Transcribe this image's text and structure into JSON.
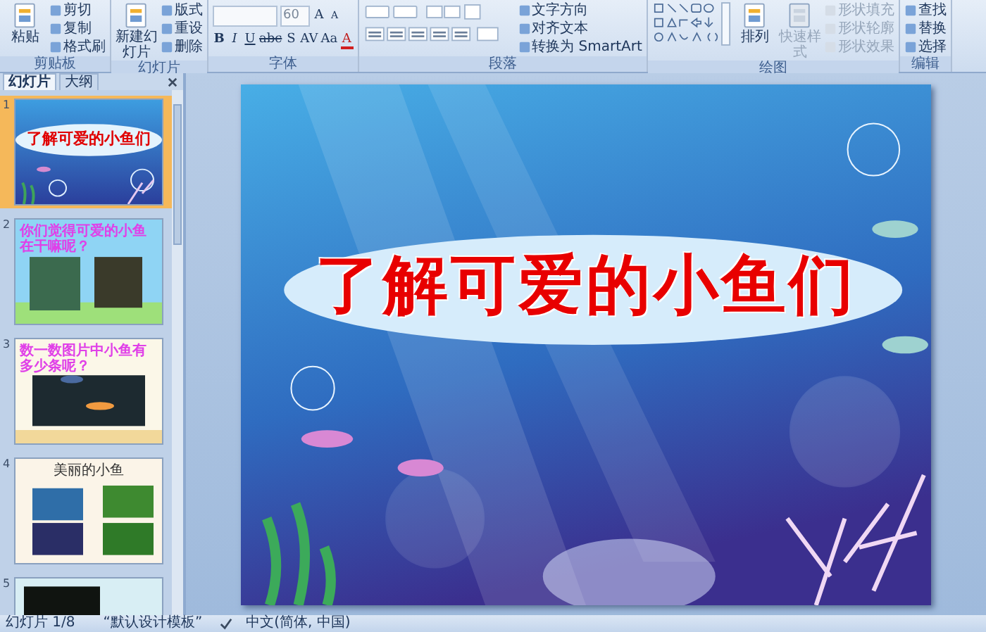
{
  "ribbon": {
    "groups": [
      {
        "label": "剪贴板",
        "kind": "buttons",
        "large": [
          {
            "label": "粘贴",
            "disabled": false
          }
        ],
        "small": [
          {
            "label": "剪切",
            "disabled": false
          },
          {
            "label": "复制",
            "disabled": false
          },
          {
            "label": "格式刷",
            "disabled": false
          }
        ]
      },
      {
        "label": "幻灯片",
        "kind": "buttons",
        "large": [
          {
            "label": "新建幻灯片",
            "disabled": false
          }
        ],
        "small": [
          {
            "label": "版式",
            "disabled": false
          },
          {
            "label": "重设",
            "disabled": false
          },
          {
            "label": "删除",
            "disabled": false
          }
        ]
      },
      {
        "label": "字体",
        "kind": "font",
        "font_size": "60",
        "size_buttons": [
          "A",
          "A"
        ],
        "format_buttons": [
          "B",
          "I",
          "U",
          "abc",
          "S",
          "AV",
          "Aa",
          "A"
        ]
      },
      {
        "label": "段落",
        "kind": "paragraph",
        "small": [
          {
            "label": "文字方向",
            "disabled": false
          },
          {
            "label": "对齐文本",
            "disabled": false
          },
          {
            "label": "转换为 SmartArt",
            "disabled": false
          }
        ]
      },
      {
        "label": "绘图",
        "kind": "drawing",
        "large": [
          {
            "label": "排列",
            "disabled": false
          },
          {
            "label": "快速样式",
            "disabled": true
          }
        ],
        "small": [
          {
            "label": "形状填充",
            "disabled": true
          },
          {
            "label": "形状轮廓",
            "disabled": true
          },
          {
            "label": "形状效果",
            "disabled": true
          }
        ]
      },
      {
        "label": "编辑",
        "kind": "buttons",
        "small": [
          {
            "label": "查找",
            "disabled": false
          },
          {
            "label": "替换",
            "disabled": false
          },
          {
            "label": "选择",
            "disabled": false
          }
        ]
      }
    ]
  },
  "panel": {
    "tabs": [
      {
        "label": "幻灯片",
        "selected": true
      },
      {
        "label": "大纲",
        "selected": false
      }
    ],
    "slides": [
      {
        "number": "1",
        "selected": true,
        "kind": "title",
        "title": "了解可爱的小鱼们"
      },
      {
        "number": "2",
        "selected": false,
        "kind": "two-photos",
        "title": "你们觉得可爱的小鱼在干嘛呢？"
      },
      {
        "number": "3",
        "selected": false,
        "kind": "one-photo",
        "title": "数一数图片中小鱼有多少条呢？"
      },
      {
        "number": "4",
        "selected": false,
        "kind": "four-photos",
        "title": "美丽的小鱼"
      },
      {
        "number": "5",
        "selected": false,
        "kind": "dark-photo"
      }
    ]
  },
  "slide": {
    "title": "了解可爱的小鱼们"
  },
  "status_bar": {
    "slide_count": "幻灯片 1/8",
    "theme": "“默认设计模板”",
    "language": "中文(简体, 中国)"
  }
}
